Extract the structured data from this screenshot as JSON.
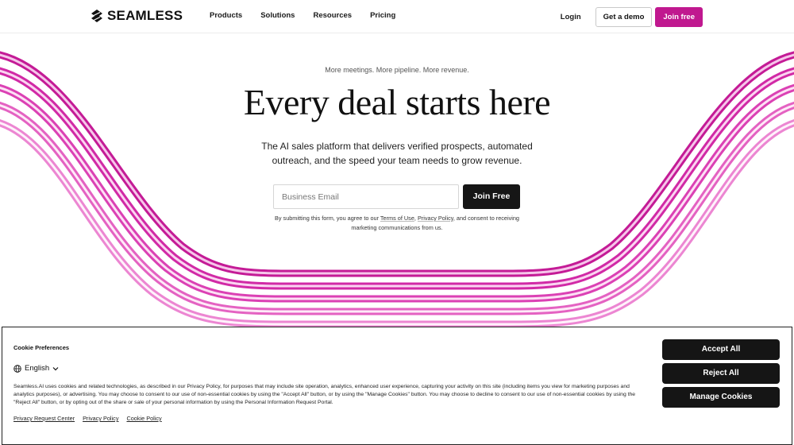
{
  "brand": {
    "name": "SEAMLESS",
    "accent": "#c0188f"
  },
  "nav": {
    "links": [
      "Products",
      "Solutions",
      "Resources",
      "Pricing"
    ],
    "login": "Login",
    "demo": "Get a demo",
    "join": "Join free"
  },
  "hero": {
    "tagline": "More meetings. More pipeline. More revenue.",
    "headline": "Every deal starts here",
    "subtitle": "The AI sales platform that delivers verified prospects, automated outreach, and the speed your team needs to grow revenue.",
    "email_placeholder": "Business Email",
    "cta": "Join Free",
    "legal_pre": "By submitting this form, you agree to our ",
    "legal_terms": "Terms of Use",
    "legal_sep": ", ",
    "legal_privacy": "Privacy Policy",
    "legal_post": ", and consent to receiving marketing communications from us."
  },
  "cookie": {
    "title": "Cookie Preferences",
    "language": "English",
    "body": "Seamless.AI uses cookies and related technologies, as described in our Privacy Policy, for purposes that may include site operation, analytics, enhanced user experience, capturing your activity on this site (including items you view for marketing purposes and analytics purposes), or advertising. You may choose to consent to our use of non-essential cookies by using the \"Accept All\" button, or by using the \"Manage Cookies\" button. You may choose to decline to consent to our use of non-essential cookies by using the \"Reject All\" button, or by opting out of the share or sale of your personal information by using the Personal Information Request Portal.",
    "links": [
      "Privacy Request Center",
      "Privacy Policy",
      "Cookie Policy"
    ],
    "accept": "Accept All",
    "reject": "Reject All",
    "manage": "Manage Cookies"
  }
}
